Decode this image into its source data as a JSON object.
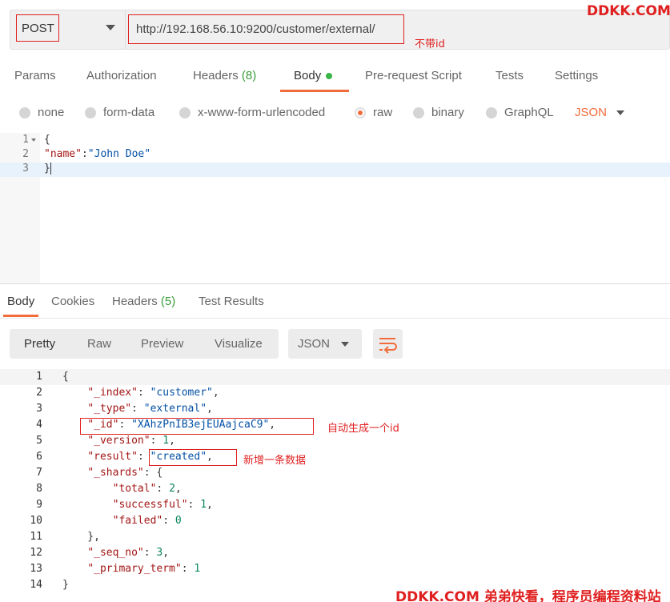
{
  "request": {
    "method": "POST",
    "url": "http://192.168.56.10:9200/customer/external/",
    "url_note": "不带id"
  },
  "watermark_top": "DDKK.COM",
  "watermark_bottom": "DDKK.COM 弟弟快看，程序员编程资料站",
  "request_tabs": [
    {
      "label": "Params"
    },
    {
      "label": "Authorization"
    },
    {
      "label": "Headers",
      "count": "(8)"
    },
    {
      "label": "Body"
    },
    {
      "label": "Pre-request Script"
    },
    {
      "label": "Tests"
    },
    {
      "label": "Settings"
    }
  ],
  "body_types": [
    "none",
    "form-data",
    "x-www-form-urlencoded",
    "raw",
    "binary",
    "GraphQL"
  ],
  "body_selected": "raw",
  "body_language": "JSON",
  "request_body": {
    "line_numbers": [
      "1",
      "2",
      "3"
    ],
    "open": "{",
    "key": "\"name\"",
    "colon": ":",
    "value": "\"John Doe\"",
    "close": "}"
  },
  "response_tabs": [
    {
      "label": "Body"
    },
    {
      "label": "Cookies"
    },
    {
      "label": "Headers",
      "count": "(5)"
    },
    {
      "label": "Test Results"
    }
  ],
  "response_formats": [
    "Pretty",
    "Raw",
    "Preview",
    "Visualize"
  ],
  "response_language": "JSON",
  "response_lines": [
    {
      "n": "1",
      "code": "{"
    },
    {
      "n": "2",
      "code": "    \"_index\": \"customer\","
    },
    {
      "n": "3",
      "code": "    \"_type\": \"external\","
    },
    {
      "n": "4",
      "code": "    \"_id\": \"XAhzPnIB3ejEUAajcaC9\","
    },
    {
      "n": "5",
      "code": "    \"_version\": 1,"
    },
    {
      "n": "6",
      "code": "    \"result\": \"created\","
    },
    {
      "n": "7",
      "code": "    \"_shards\": {"
    },
    {
      "n": "8",
      "code": "        \"total\": 2,"
    },
    {
      "n": "9",
      "code": "        \"successful\": 1,"
    },
    {
      "n": "10",
      "code": "        \"failed\": 0"
    },
    {
      "n": "11",
      "code": "    },"
    },
    {
      "n": "12",
      "code": "    \"_seq_no\": 3,"
    },
    {
      "n": "13",
      "code": "    \"_primary_term\": 1"
    },
    {
      "n": "14",
      "code": "}"
    }
  ],
  "annotations": {
    "id_note": "自动生成一个id",
    "created_note": "新增一条数据"
  },
  "colors": {
    "accent": "#f26b3a",
    "annotation": "#e02020",
    "count": "#3a9d3a"
  }
}
